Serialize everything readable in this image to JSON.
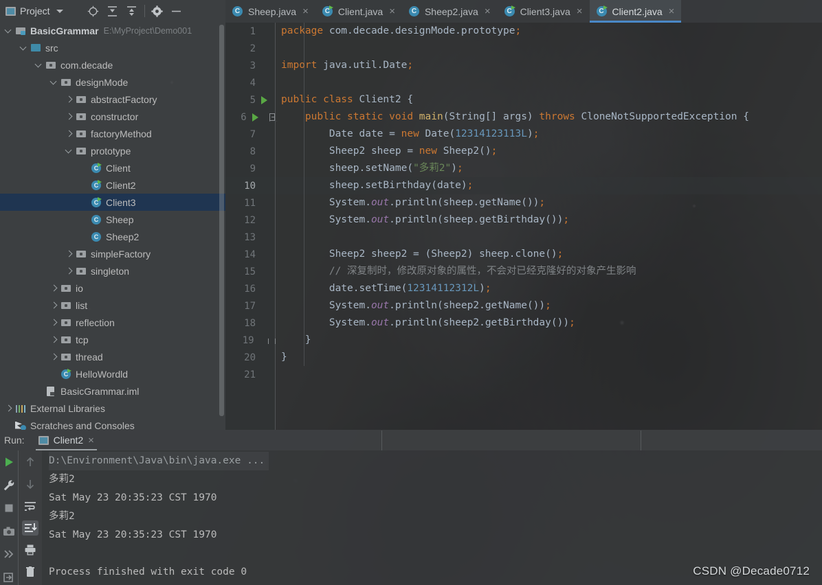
{
  "project_panel": {
    "title": "Project",
    "icons": [
      "locate-icon",
      "expand-all-icon",
      "collapse-all-icon",
      "settings-gear-icon",
      "minimize-icon"
    ],
    "tree": [
      {
        "depth": 0,
        "arrow": "down",
        "icon": "module-icon",
        "label": "BasicGrammar",
        "bold": true,
        "path": "E:\\MyProject\\Demo001",
        "selected": false
      },
      {
        "depth": 1,
        "arrow": "down",
        "icon": "source-folder-icon",
        "label": "src",
        "bold": false,
        "path": "",
        "selected": false
      },
      {
        "depth": 2,
        "arrow": "down",
        "icon": "package-icon",
        "label": "com.decade",
        "bold": false,
        "path": "",
        "selected": false
      },
      {
        "depth": 3,
        "arrow": "down",
        "icon": "package-icon",
        "label": "designMode",
        "bold": false,
        "path": "",
        "selected": false
      },
      {
        "depth": 4,
        "arrow": "right",
        "icon": "package-icon",
        "label": "abstractFactory",
        "bold": false,
        "path": "",
        "selected": false
      },
      {
        "depth": 4,
        "arrow": "right",
        "icon": "package-icon",
        "label": "constructor",
        "bold": false,
        "path": "",
        "selected": false
      },
      {
        "depth": 4,
        "arrow": "right",
        "icon": "package-icon",
        "label": "factoryMethod",
        "bold": false,
        "path": "",
        "selected": false
      },
      {
        "depth": 4,
        "arrow": "down",
        "icon": "package-icon",
        "label": "prototype",
        "bold": false,
        "path": "",
        "selected": false
      },
      {
        "depth": 5,
        "arrow": "none",
        "icon": "java-class-runnable-icon",
        "label": "Client",
        "bold": false,
        "path": "",
        "selected": false
      },
      {
        "depth": 5,
        "arrow": "none",
        "icon": "java-class-runnable-icon",
        "label": "Client2",
        "bold": false,
        "path": "",
        "selected": false
      },
      {
        "depth": 5,
        "arrow": "none",
        "icon": "java-class-runnable-icon",
        "label": "Client3",
        "bold": false,
        "path": "",
        "selected": true
      },
      {
        "depth": 5,
        "arrow": "none",
        "icon": "java-class-icon",
        "label": "Sheep",
        "bold": false,
        "path": "",
        "selected": false
      },
      {
        "depth": 5,
        "arrow": "none",
        "icon": "java-class-icon",
        "label": "Sheep2",
        "bold": false,
        "path": "",
        "selected": false
      },
      {
        "depth": 4,
        "arrow": "right",
        "icon": "package-icon",
        "label": "simpleFactory",
        "bold": false,
        "path": "",
        "selected": false
      },
      {
        "depth": 4,
        "arrow": "right",
        "icon": "package-icon",
        "label": "singleton",
        "bold": false,
        "path": "",
        "selected": false
      },
      {
        "depth": 3,
        "arrow": "right",
        "icon": "package-icon",
        "label": "io",
        "bold": false,
        "path": "",
        "selected": false
      },
      {
        "depth": 3,
        "arrow": "right",
        "icon": "package-icon",
        "label": "list",
        "bold": false,
        "path": "",
        "selected": false
      },
      {
        "depth": 3,
        "arrow": "right",
        "icon": "package-icon",
        "label": "reflection",
        "bold": false,
        "path": "",
        "selected": false
      },
      {
        "depth": 3,
        "arrow": "right",
        "icon": "package-icon",
        "label": "tcp",
        "bold": false,
        "path": "",
        "selected": false
      },
      {
        "depth": 3,
        "arrow": "right",
        "icon": "package-icon",
        "label": "thread",
        "bold": false,
        "path": "",
        "selected": false
      },
      {
        "depth": 3,
        "arrow": "none",
        "icon": "java-class-runnable-icon",
        "label": "HelloWordld",
        "bold": false,
        "path": "",
        "selected": false
      },
      {
        "depth": 2,
        "arrow": "none",
        "icon": "iml-file-icon",
        "label": "BasicGrammar.iml",
        "bold": false,
        "path": "",
        "selected": false
      },
      {
        "depth": 0,
        "arrow": "right",
        "icon": "external-libraries-icon",
        "label": "External Libraries",
        "bold": false,
        "path": "",
        "selected": false
      },
      {
        "depth": 0,
        "arrow": "none",
        "icon": "scratches-icon",
        "label": "Scratches and Consoles",
        "bold": false,
        "path": "",
        "selected": false
      }
    ]
  },
  "editor": {
    "tabs": [
      {
        "label": "Sheep.java",
        "runnable": false,
        "active": false
      },
      {
        "label": "Client.java",
        "runnable": true,
        "active": false
      },
      {
        "label": "Sheep2.java",
        "runnable": false,
        "active": false
      },
      {
        "label": "Client3.java",
        "runnable": true,
        "active": false
      },
      {
        "label": "Client2.java",
        "runnable": true,
        "active": true
      }
    ],
    "close_glyph": "×",
    "active_tab_underline_color": "#4a88c7",
    "lines": [
      {
        "n": 1,
        "run": false,
        "fold": "",
        "current": false,
        "tokens": [
          {
            "t": "package ",
            "c": "kw"
          },
          {
            "t": "com.decade.designMode.prototype",
            "c": "id"
          },
          {
            "t": ";",
            "c": "kw"
          }
        ]
      },
      {
        "n": 2,
        "run": false,
        "fold": "",
        "current": false,
        "tokens": []
      },
      {
        "n": 3,
        "run": false,
        "fold": "",
        "current": false,
        "tokens": [
          {
            "t": "import ",
            "c": "kw"
          },
          {
            "t": "java.util.Date",
            "c": "id"
          },
          {
            "t": ";",
            "c": "kw"
          }
        ]
      },
      {
        "n": 4,
        "run": false,
        "fold": "",
        "current": false,
        "tokens": []
      },
      {
        "n": 5,
        "run": true,
        "fold": "",
        "current": false,
        "tokens": [
          {
            "t": "public class ",
            "c": "kw"
          },
          {
            "t": "Client2 {",
            "c": "id"
          }
        ]
      },
      {
        "n": 6,
        "run": true,
        "fold": "minus",
        "current": false,
        "tokens": [
          {
            "t": "    ",
            "c": "id"
          },
          {
            "t": "public static void ",
            "c": "kw"
          },
          {
            "t": "main",
            "c": "fn"
          },
          {
            "t": "(String[] args) ",
            "c": "id"
          },
          {
            "t": "throws ",
            "c": "kw"
          },
          {
            "t": "CloneNotSupportedException {",
            "c": "id"
          }
        ]
      },
      {
        "n": 7,
        "run": false,
        "fold": "",
        "current": false,
        "tokens": [
          {
            "t": "        Date date = ",
            "c": "id"
          },
          {
            "t": "new ",
            "c": "kw"
          },
          {
            "t": "Date(",
            "c": "id"
          },
          {
            "t": "12314123113L",
            "c": "num"
          },
          {
            "t": ")",
            "c": "id"
          },
          {
            "t": ";",
            "c": "kw"
          }
        ]
      },
      {
        "n": 8,
        "run": false,
        "fold": "",
        "current": false,
        "tokens": [
          {
            "t": "        Sheep2 sheep = ",
            "c": "id"
          },
          {
            "t": "new ",
            "c": "kw"
          },
          {
            "t": "Sheep2()",
            "c": "id"
          },
          {
            "t": ";",
            "c": "kw"
          }
        ]
      },
      {
        "n": 9,
        "run": false,
        "fold": "",
        "current": false,
        "tokens": [
          {
            "t": "        sheep.setName(",
            "c": "id"
          },
          {
            "t": "\"多莉2\"",
            "c": "str"
          },
          {
            "t": ")",
            "c": "id"
          },
          {
            "t": ";",
            "c": "kw"
          }
        ]
      },
      {
        "n": 10,
        "run": false,
        "fold": "",
        "current": true,
        "tokens": [
          {
            "t": "        sheep.setBirthday(date)",
            "c": "id"
          },
          {
            "t": ";",
            "c": "kw"
          }
        ]
      },
      {
        "n": 11,
        "run": false,
        "fold": "",
        "current": false,
        "tokens": [
          {
            "t": "        System.",
            "c": "id"
          },
          {
            "t": "out",
            "c": "stat"
          },
          {
            "t": ".println(sheep.getName())",
            "c": "id"
          },
          {
            "t": ";",
            "c": "kw"
          }
        ]
      },
      {
        "n": 12,
        "run": false,
        "fold": "",
        "current": false,
        "tokens": [
          {
            "t": "        System.",
            "c": "id"
          },
          {
            "t": "out",
            "c": "stat"
          },
          {
            "t": ".println(sheep.getBirthday())",
            "c": "id"
          },
          {
            "t": ";",
            "c": "kw"
          }
        ]
      },
      {
        "n": 13,
        "run": false,
        "fold": "",
        "current": false,
        "tokens": []
      },
      {
        "n": 14,
        "run": false,
        "fold": "",
        "current": false,
        "tokens": [
          {
            "t": "        Sheep2 sheep2 = (Sheep2) sheep.clone()",
            "c": "id"
          },
          {
            "t": ";",
            "c": "kw"
          }
        ]
      },
      {
        "n": 15,
        "run": false,
        "fold": "",
        "current": false,
        "tokens": [
          {
            "t": "        // 深复制时，修改原对象的属性，不会对已经克隆好的对象产生影响",
            "c": "cmt"
          }
        ]
      },
      {
        "n": 16,
        "run": false,
        "fold": "",
        "current": false,
        "tokens": [
          {
            "t": "        date.setTime(",
            "c": "id"
          },
          {
            "t": "12314112312L",
            "c": "num"
          },
          {
            "t": ")",
            "c": "id"
          },
          {
            "t": ";",
            "c": "kw"
          }
        ]
      },
      {
        "n": 17,
        "run": false,
        "fold": "",
        "current": false,
        "tokens": [
          {
            "t": "        System.",
            "c": "id"
          },
          {
            "t": "out",
            "c": "stat"
          },
          {
            "t": ".println(sheep2.getName())",
            "c": "id"
          },
          {
            "t": ";",
            "c": "kw"
          }
        ]
      },
      {
        "n": 18,
        "run": false,
        "fold": "",
        "current": false,
        "tokens": [
          {
            "t": "        System.",
            "c": "id"
          },
          {
            "t": "out",
            "c": "stat"
          },
          {
            "t": ".println(sheep2.getBirthday())",
            "c": "id"
          },
          {
            "t": ";",
            "c": "kw"
          }
        ]
      },
      {
        "n": 19,
        "run": false,
        "fold": "end",
        "current": false,
        "tokens": [
          {
            "t": "    }",
            "c": "id"
          }
        ]
      },
      {
        "n": 20,
        "run": false,
        "fold": "",
        "current": false,
        "tokens": [
          {
            "t": "}",
            "c": "id"
          }
        ]
      },
      {
        "n": 21,
        "run": false,
        "fold": "",
        "current": false,
        "tokens": []
      }
    ]
  },
  "run_panel": {
    "label": "Run:",
    "tab_label": "Client2",
    "tab_close_glyph": "×",
    "toolbar_left": [
      "rerun-run-icon",
      "settings-wrench-icon",
      "stop-icon",
      "camera-icon",
      "thread-dump-icon",
      "export-icon"
    ],
    "toolbar_right": [
      "up-arrow-icon",
      "down-arrow-icon",
      "soft-wrap-icon",
      "scroll-to-end-icon",
      "print-icon",
      "trash-icon"
    ],
    "console_lines": [
      {
        "text": "D:\\Environment\\Java\\bin\\java.exe ...",
        "cmd": true
      },
      {
        "text": "多莉2",
        "cmd": false
      },
      {
        "text": "Sat May 23 20:35:23 CST 1970",
        "cmd": false
      },
      {
        "text": "多莉2",
        "cmd": false
      },
      {
        "text": "Sat May 23 20:35:23 CST 1970",
        "cmd": false
      },
      {
        "text": "",
        "cmd": false
      },
      {
        "text": "Process finished with exit code 0",
        "cmd": false
      }
    ]
  },
  "watermark": {
    "text": "CSDN @Decade0712"
  },
  "colors": {
    "accent_blue": "#4a88c7",
    "selection_blue": "#1f3551",
    "keyword_orange": "#cc7832",
    "string_green": "#6a8759",
    "number_blue": "#6897bb",
    "comment_gray": "#7f8386",
    "method_yellow": "#d0b06a",
    "static_purple": "#9876aa",
    "panel_bg": "#3c3f41",
    "editor_bg": "#2b2b2b",
    "run_green": "#59a844"
  }
}
